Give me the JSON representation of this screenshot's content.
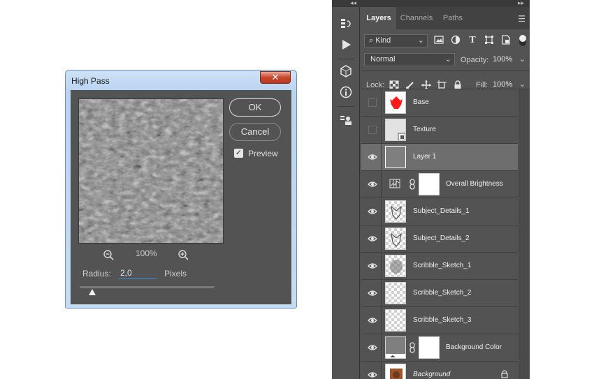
{
  "dialog": {
    "title": "High Pass",
    "close_symbol": "✕",
    "ok_label": "OK",
    "cancel_label": "Cancel",
    "preview_label": "Preview",
    "preview_checked": true,
    "zoom_level": "100%",
    "radius_label": "Radius:",
    "radius_value": "2,0",
    "units_label": "Pixels"
  },
  "panels": {
    "tabs": [
      {
        "label": "Layers",
        "active": true
      },
      {
        "label": "Channels",
        "active": false
      },
      {
        "label": "Paths",
        "active": false
      }
    ],
    "filter": {
      "kind_label": "Kind",
      "icons": [
        "image-filter-icon",
        "adjustment-filter-icon",
        "type-filter-icon",
        "shape-filter-icon",
        "smart-object-filter-icon"
      ]
    },
    "blend_mode": "Normal",
    "opacity_label": "Opacity:",
    "opacity_value": "100%",
    "lock_label": "Lock:",
    "fill_label": "Fill:",
    "fill_value": "100%"
  },
  "layers": [
    {
      "name": "Base",
      "visible": false,
      "thumb": "red-shape"
    },
    {
      "name": "Texture",
      "visible": false,
      "thumb": "texture-smart"
    },
    {
      "name": "Layer 1",
      "visible": true,
      "thumb": "gray",
      "selected": true
    },
    {
      "name": "Overall Brightness",
      "visible": true,
      "thumb": "adjustment-mask"
    },
    {
      "name": "Subject_Details_1",
      "visible": true,
      "thumb": "checker-sketch"
    },
    {
      "name": "Subject_Details_2",
      "visible": true,
      "thumb": "checker-sketch"
    },
    {
      "name": "Scribble_Sketch_1",
      "visible": true,
      "thumb": "checker-scribble"
    },
    {
      "name": "Scribble_Sketch_2",
      "visible": true,
      "thumb": "checker"
    },
    {
      "name": "Scribble_Sketch_3",
      "visible": true,
      "thumb": "checker"
    },
    {
      "name": "Background Color",
      "visible": true,
      "thumb": "gray-mask"
    },
    {
      "name": "Background",
      "visible": true,
      "thumb": "photo",
      "locked": true
    }
  ],
  "colors": {
    "panel_bg": "#535353",
    "selected_row": "#6e6e6e",
    "accent_blue": "#3b8ee0"
  }
}
